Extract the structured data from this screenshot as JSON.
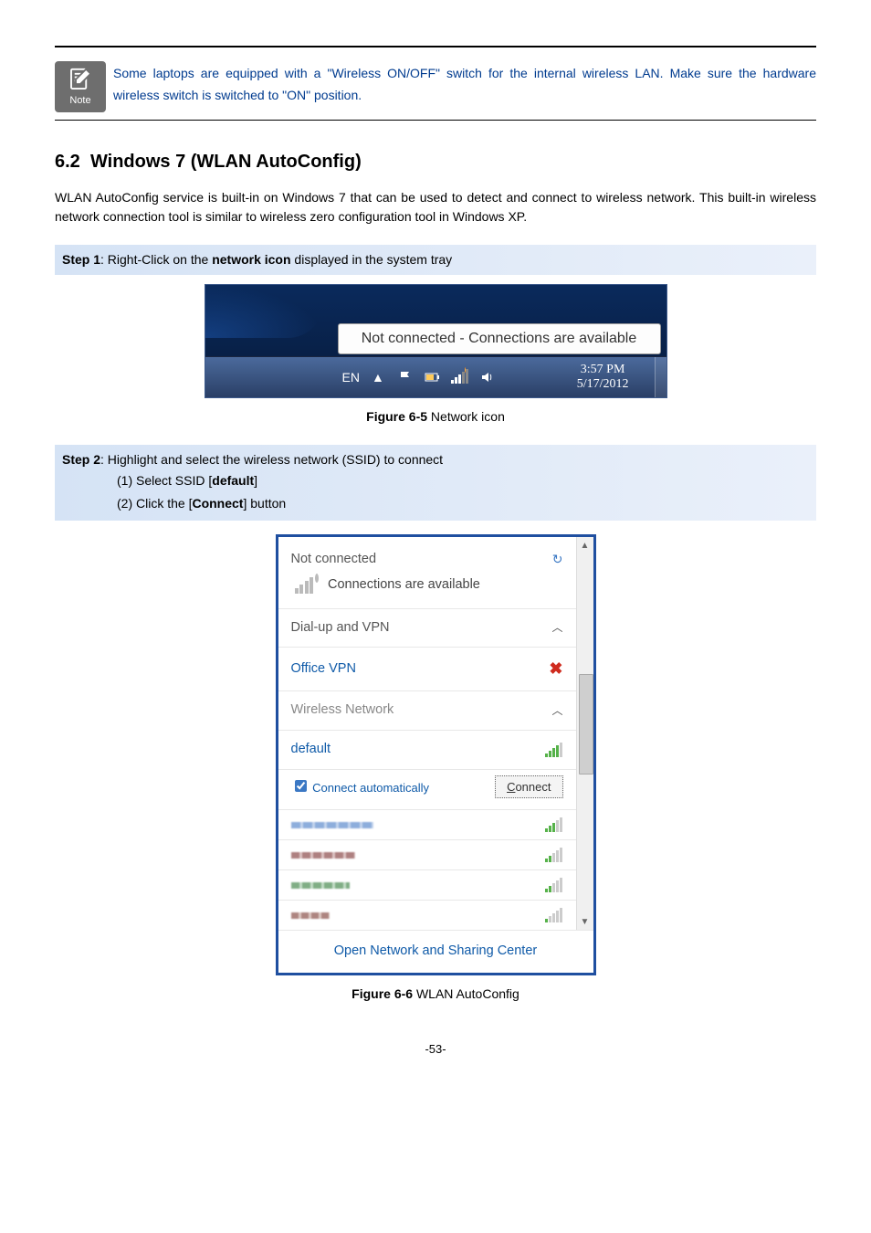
{
  "note": {
    "label": "Note",
    "text": "Some laptops are equipped with a \"Wireless ON/OFF\" switch for the internal wireless LAN. Make sure the hardware wireless switch is switched to \"ON\" position."
  },
  "section": {
    "number": "6.2",
    "title": "Windows 7 (WLAN AutoConfig)",
    "intro": "WLAN AutoConfig service is built-in on Windows 7 that can be used to detect and connect to wireless network. This built-in wireless network connection tool is similar to wireless zero configuration tool in Windows XP."
  },
  "step1": {
    "label": "Step 1",
    "text_before": ": Right-Click on the ",
    "bold": "network icon",
    "text_after": " displayed in the system tray"
  },
  "tray": {
    "tooltip": "Not connected - Connections are available",
    "lang": "EN",
    "time": "3:57 PM",
    "date": "5/17/2012"
  },
  "fig1": {
    "label": "Figure 6-5",
    "caption": " Network icon"
  },
  "step2": {
    "label": "Step 2",
    "text": ": Highlight and select the wireless network (SSID) to connect",
    "item1_pre": "(1)  Select SSID [",
    "item1_bold": "default",
    "item1_post": "]",
    "item2_pre": "(2)  Click the [",
    "item2_bold": "Connect",
    "item2_post": "] button"
  },
  "wlan": {
    "not_connected": "Not connected",
    "connections_available": "Connections are available",
    "dialup": "Dial-up and VPN",
    "office_vpn": "Office VPN",
    "wireless_network": "Wireless Network",
    "default_ssid": "default",
    "connect_auto": "Connect automatically",
    "connect_btn": "Connect",
    "footer": "Open Network and Sharing Center"
  },
  "fig2": {
    "label": "Figure 6-6",
    "caption": " WLAN AutoConfig"
  },
  "page_number": "-53-"
}
